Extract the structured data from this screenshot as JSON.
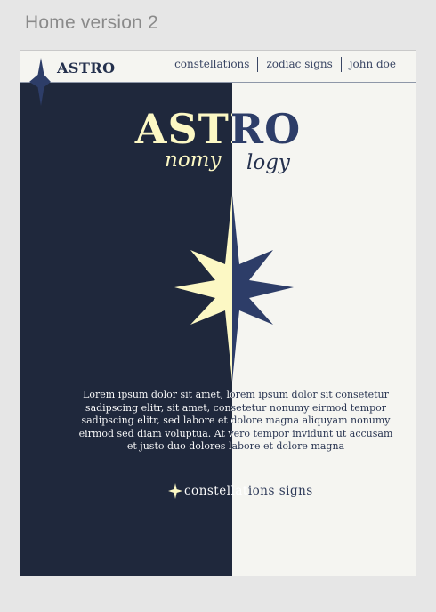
{
  "frame": {
    "label": "Home version 2"
  },
  "header": {
    "brand": "ASTRO",
    "nav": [
      "constellations",
      "zodiac signs",
      "john doe"
    ]
  },
  "hero": {
    "title": "ASTRO",
    "subtitle_left": "nomy",
    "subtitle_right": "logy"
  },
  "body": {
    "paragraph": "Lorem ipsum dolor sit amet, lorem ipsum dolor sit consetetur sadipscing elitr, sit amet, consetetur nonumy eirmod tempor sadipscing elitr, sed labore et dolore magna aliquyam nonumy eirmod sed diam voluptua. At vero tempor invidunt ut accusam et justo duo dolores labore et dolore magna"
  },
  "cta": {
    "label": "constellations signs",
    "icon": "sparkle-icon"
  },
  "colors": {
    "navy": "#1f283c",
    "cream": "#fcf8c4",
    "paper": "#f5f5f1",
    "blue": "#2d3d68"
  }
}
